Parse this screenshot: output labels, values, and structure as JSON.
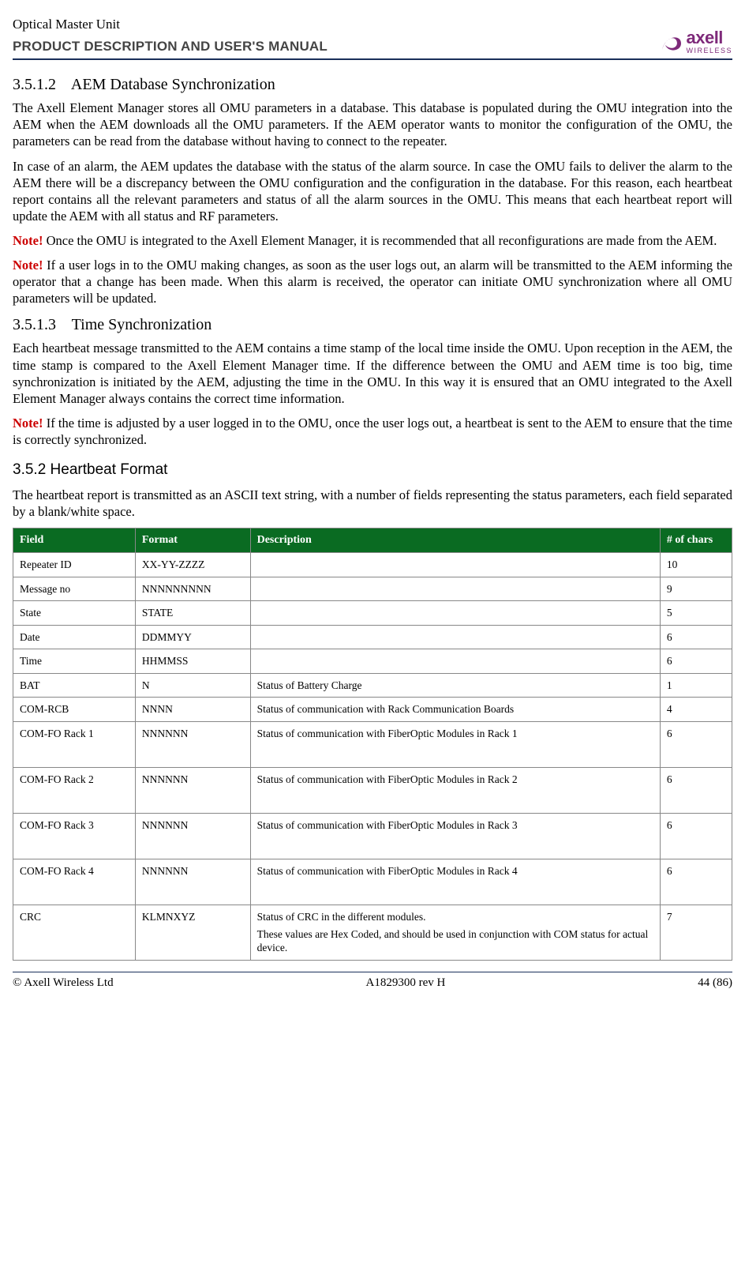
{
  "header": {
    "title": "Optical Master Unit",
    "subtitle": "PRODUCT DESCRIPTION AND USER'S MANUAL",
    "logo_brand": "axell",
    "logo_sub": "WIRELESS"
  },
  "sections": {
    "s35_1_2": {
      "num": "3.5.1.2",
      "title": "AEM Database Synchronization",
      "p1": "The Axell Element Manager stores all OMU parameters in a database. This database is populated during the OMU integration into the AEM when the AEM downloads all the OMU parameters. If the AEM operator wants to monitor the configuration of the OMU, the parameters can be read from the database without having to connect to the repeater.",
      "p2": "In case of an alarm, the AEM updates the database with the status of the alarm source. In case the OMU fails to deliver the alarm to the AEM there will be a discrepancy between the OMU configuration and the configuration in the database. For this reason, each heartbeat report contains all the relevant parameters and status of all the alarm sources in the OMU. This means that each heartbeat report will update the AEM with all status and RF parameters.",
      "note1_label": "Note!",
      "note1_body": " Once the OMU is integrated to the Axell Element Manager, it is recommended that all reconfigurations are made from the AEM.",
      "note2_label": "Note!",
      "note2_body": " If a user logs in to the OMU making changes, as soon as the user logs out, an alarm will be transmitted to the AEM informing the operator that a change has been made. When this alarm is received, the operator can initiate OMU synchronization where all OMU parameters will be updated."
    },
    "s35_1_3": {
      "num": "3.5.1.3",
      "title": "Time Synchronization",
      "p1": "Each heartbeat message transmitted to the AEM contains a time stamp of the local time inside the OMU. Upon reception in the AEM, the time stamp is compared to the Axell Element Manager time. If the difference between the OMU and AEM time is too big, time synchronization is initiated by the AEM, adjusting the time in the OMU. In this way it is ensured that an OMU integrated to the Axell Element Manager always contains the correct time information.",
      "note1_label": "Note!",
      "note1_body": " If the time is adjusted by a user logged in to the OMU, once the user logs out, a heartbeat is sent to the AEM to ensure that the time is correctly synchronized."
    },
    "s35_2": {
      "num": "3.5.2",
      "title": "Heartbeat Format",
      "p1": "The heartbeat report is transmitted as an ASCII text string, with a number of fields representing the status parameters, each field separated by a blank/white space."
    }
  },
  "table": {
    "headers": {
      "field": "Field",
      "format": "Format",
      "desc": "Description",
      "chars": "# of chars"
    },
    "rows": [
      {
        "field": "Repeater ID",
        "format": "XX-YY-ZZZZ",
        "desc": "",
        "chars": "10",
        "tall": false
      },
      {
        "field": "Message no",
        "format": "NNNNNNNNN",
        "desc": "",
        "chars": "9",
        "tall": false
      },
      {
        "field": "State",
        "format": "STATE",
        "desc": "",
        "chars": "5",
        "tall": false
      },
      {
        "field": "Date",
        "format": "DDMMYY",
        "desc": "",
        "chars": "6",
        "tall": false
      },
      {
        "field": "Time",
        "format": "HHMMSS",
        "desc": "",
        "chars": "6",
        "tall": false
      },
      {
        "field": "BAT",
        "format": "N",
        "desc": "Status of Battery Charge",
        "chars": "1",
        "tall": false
      },
      {
        "field": "COM-RCB",
        "format": "NNNN",
        "desc": "Status of communication with Rack Communication Boards",
        "chars": "4",
        "tall": false
      },
      {
        "field": "COM-FO Rack 1",
        "format": "NNNNNN",
        "desc": "Status of communication with FiberOptic Modules in Rack 1",
        "chars": "6",
        "tall": true
      },
      {
        "field": "COM-FO Rack 2",
        "format": "NNNNNN",
        "desc": "Status of communication with FiberOptic Modules in Rack 2",
        "chars": "6",
        "tall": true
      },
      {
        "field": "COM-FO Rack 3",
        "format": "NNNNNN",
        "desc": "Status of communication with FiberOptic Modules in Rack 3",
        "chars": "6",
        "tall": true
      },
      {
        "field": "COM-FO Rack 4",
        "format": "NNNNNN",
        "desc": "Status of communication with FiberOptic Modules in Rack 4",
        "chars": "6",
        "tall": true
      },
      {
        "field": "CRC",
        "format": "KLMNXYZ",
        "desc": "Status of CRC in the different modules.",
        "desc2": "These values are Hex Coded, and should be used in conjunction with COM status for actual device.",
        "chars": "7",
        "tall": true
      }
    ]
  },
  "footer": {
    "left": "© Axell Wireless Ltd",
    "center": "A1829300 rev H",
    "right": "44 (86)"
  }
}
